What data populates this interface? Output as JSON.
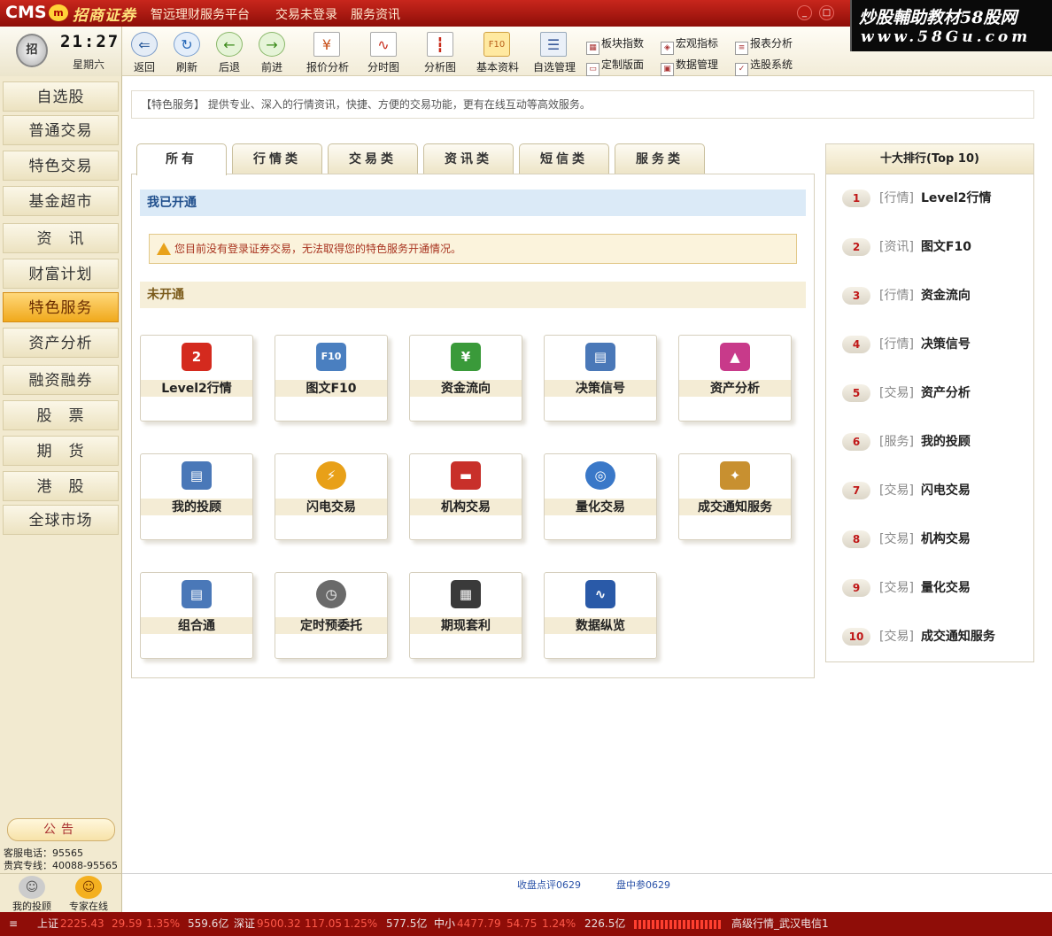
{
  "app": {
    "logo_cms": "CMS",
    "logo_mark": "m",
    "logo_name": "招商证券",
    "title_links": [
      "智远理财服务平台",
      "交易未登录",
      "服务资讯"
    ],
    "watermark_line1": "炒股輔助教材58股网",
    "watermark_line2": "www.58Gu.com"
  },
  "clock": {
    "time": "21:27",
    "day": "星期六"
  },
  "toolbar": {
    "buttons": [
      {
        "label": "返回",
        "icon": "back-arrow-icon"
      },
      {
        "label": "刷新",
        "icon": "refresh-icon"
      },
      {
        "label": "后退",
        "icon": "left-arrow-icon"
      },
      {
        "label": "前进",
        "icon": "right-arrow-icon"
      },
      {
        "label": "报价分析",
        "icon": "quote-doc-icon"
      },
      {
        "label": "分时图",
        "icon": "intraday-chart-icon"
      },
      {
        "label": "分析图",
        "icon": "kline-chart-icon"
      },
      {
        "label": "基本资料",
        "icon": "f10-icon"
      },
      {
        "label": "自选管理",
        "icon": "portfolio-icon"
      }
    ],
    "small_buttons": [
      {
        "label": "板块指数",
        "icon": "sector-index-icon"
      },
      {
        "label": "宏观指标",
        "icon": "macro-icon"
      },
      {
        "label": "报表分析",
        "icon": "report-icon"
      },
      {
        "label": "定制版面",
        "icon": "layout-icon"
      },
      {
        "label": "数据管理",
        "icon": "data-mgmt-icon"
      },
      {
        "label": "选股系统",
        "icon": "stock-picker-icon"
      }
    ]
  },
  "sidebar": {
    "items": [
      "自选股",
      "普通交易",
      "特色交易",
      "基金超市",
      "资　讯",
      "财富计划",
      "特色服务",
      "资产分析",
      "融资融券",
      "股　票",
      "期　货",
      "港　股",
      "全球市场"
    ],
    "active": "特色服务",
    "notice": "公告",
    "service_phone": "客服电话：95565",
    "vip_phone": "贵宾专线：40088-95565",
    "bottom": [
      "我的投顾",
      "专家在线"
    ]
  },
  "main": {
    "description": "【特色服务】 提供专业、深入的行情资讯，快捷、方便的交易功能，更有在线互动等高效服务。",
    "tabs": [
      "所有",
      "行情类",
      "交易类",
      "资讯类",
      "短信类",
      "服务类"
    ],
    "active_tab": "所有",
    "opened_title": "我已开通",
    "warning": "您目前没有登录证券交易，无法取得您的特色服务开通情况。",
    "closed_title": "未开通",
    "cards": [
      {
        "label": "Level2行情",
        "icon": "level2-icon",
        "glyph": "2",
        "color": "#d42a1e"
      },
      {
        "label": "图文F10",
        "icon": "f10-doc-icon",
        "glyph": "F10",
        "color": "#4a7fc0"
      },
      {
        "label": "资金流向",
        "icon": "money-flow-icon",
        "glyph": "¥",
        "color": "#3a9a3a"
      },
      {
        "label": "决策信号",
        "icon": "decision-book-icon",
        "glyph": "▤",
        "color": "#4a78b8"
      },
      {
        "label": "资产分析",
        "icon": "asset-chart-icon",
        "glyph": "▲",
        "color": "#c83a8a"
      },
      {
        "label": "我的投顾",
        "icon": "advisor-book-icon",
        "glyph": "▤",
        "color": "#4a78b8"
      },
      {
        "label": "闪电交易",
        "icon": "lightning-icon",
        "glyph": "⚡",
        "color": "#e8a018"
      },
      {
        "label": "机构交易",
        "icon": "institution-card-icon",
        "glyph": "▬",
        "color": "#c8302a"
      },
      {
        "label": "量化交易",
        "icon": "quant-coins-icon",
        "glyph": "◎",
        "color": "#3a78c8"
      },
      {
        "label": "成交通知服务",
        "icon": "handshake-icon",
        "glyph": "✦",
        "color": "#c89030"
      },
      {
        "label": "组合通",
        "icon": "combo-book-icon",
        "glyph": "▤",
        "color": "#4a78b8"
      },
      {
        "label": "定时预委托",
        "icon": "clock-icon",
        "glyph": "◷",
        "color": "#6a6a6a"
      },
      {
        "label": "期现套利",
        "icon": "arbitrage-icon",
        "glyph": "▦",
        "color": "#3a3a3a"
      },
      {
        "label": "数据纵览",
        "icon": "data-monitor-icon",
        "glyph": "∿",
        "color": "#2a5aa8"
      }
    ]
  },
  "ranking": {
    "title": "十大排行(Top 10)",
    "items": [
      {
        "rank": "1",
        "category": "[行情]",
        "name": "Level2行情"
      },
      {
        "rank": "2",
        "category": "[资讯]",
        "name": "图文F10"
      },
      {
        "rank": "3",
        "category": "[行情]",
        "name": "资金流向"
      },
      {
        "rank": "4",
        "category": "[行情]",
        "name": "决策信号"
      },
      {
        "rank": "5",
        "category": "[交易]",
        "name": "资产分析"
      },
      {
        "rank": "6",
        "category": "[服务]",
        "name": "我的投顾"
      },
      {
        "rank": "7",
        "category": "[交易]",
        "name": "闪电交易"
      },
      {
        "rank": "8",
        "category": "[交易]",
        "name": "机构交易"
      },
      {
        "rank": "9",
        "category": "[交易]",
        "name": "量化交易"
      },
      {
        "rank": "10",
        "category": "[交易]",
        "name": "成交通知服务"
      }
    ]
  },
  "status_links": [
    "收盘点评0629",
    "盘中参0629"
  ],
  "ticker": {
    "sh_label": "上证",
    "sh_value": "2225.43",
    "sh_change": "29.59",
    "sh_pct": "1.35%",
    "sh_amount": "559.6亿",
    "sz_label": "深证",
    "sz_value": "9500.32",
    "sz_change": "117.05",
    "sz_pct": "1.25%",
    "sz_amount": "577.5亿",
    "zx_label": "中小",
    "zx_value": "4477.79",
    "zx_change": "54.75",
    "zx_pct": "1.24%",
    "zx_amount": "226.5亿",
    "server": "高级行情_武汉电信1"
  },
  "colors": {
    "brand_red": "#8f0d08",
    "active_nav": "#f0a91c",
    "up_red": "#ff5a4a"
  }
}
